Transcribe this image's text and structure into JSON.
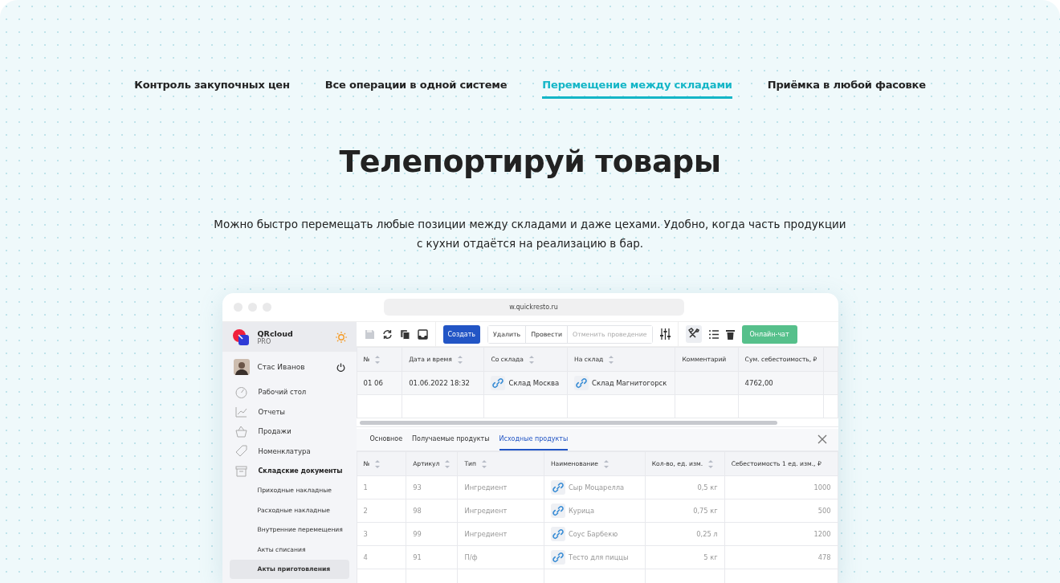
{
  "nav_tabs": [
    {
      "label": "Контроль закупочных цен",
      "selected": false
    },
    {
      "label": "Все операции в одной системе",
      "selected": false
    },
    {
      "label": "Перемещение между складами",
      "selected": true
    },
    {
      "label": "Приёмка в любой фасовке",
      "selected": false
    }
  ],
  "heading": "Телепортируй товары",
  "description": "Можно быстро перемещать любые позиции между складами и даже цехами. Удобно, когда часть продукции с кухни отдаётся на реализацию в бар.",
  "app": {
    "url": "w.quickresto.ru",
    "brand": {
      "name": "QRcloud",
      "plan": "PRO"
    },
    "user": {
      "name": "Стас Иванов"
    },
    "menu": [
      {
        "label": "Рабочий стол",
        "expanded": false
      },
      {
        "label": "Отчеты",
        "expanded": false
      },
      {
        "label": "Продажи",
        "expanded": false
      },
      {
        "label": "Номенклатура",
        "expanded": false
      },
      {
        "label": "Складские документы",
        "expanded": true,
        "children": [
          {
            "label": "Приходные накладные",
            "selected": false
          },
          {
            "label": "Расходные накладные",
            "selected": false
          },
          {
            "label": "Внутренние перемещения",
            "selected": false
          },
          {
            "label": "Акты списания",
            "selected": false
          },
          {
            "label": "Акты приготовления",
            "selected": true
          }
        ]
      }
    ],
    "toolbar": {
      "create": "Создать",
      "actions": [
        {
          "label": "Удалить",
          "disabled": false
        },
        {
          "label": "Провести",
          "disabled": false
        },
        {
          "label": "Отменить проведение",
          "disabled": true
        }
      ],
      "chat": "Онлайн-чат"
    },
    "documents": {
      "columns": [
        {
          "label": "№",
          "sortable": true,
          "kind": "text"
        },
        {
          "label": "Дата и время",
          "sortable": true,
          "kind": "text"
        },
        {
          "label": "Со склада",
          "sortable": true,
          "kind": "link"
        },
        {
          "label": "На склад",
          "sortable": true,
          "kind": "link"
        },
        {
          "label": "Комментарий",
          "sortable": false,
          "kind": "text"
        },
        {
          "label": "Сум. себестоимость, ₽",
          "sortable": false,
          "kind": "text"
        }
      ],
      "rows": [
        [
          "01 06",
          "01.06.2022 18:32",
          "Склад Москва",
          "Склад Магнитогорск",
          "",
          "4762,00"
        ]
      ]
    },
    "detail": {
      "tabs": [
        {
          "label": "Основное",
          "selected": false
        },
        {
          "label": "Получаемые продукты",
          "selected": false
        },
        {
          "label": "Исходные продукты",
          "selected": true
        }
      ],
      "columns": [
        {
          "label": "№",
          "sortable": true,
          "kind": "text"
        },
        {
          "label": "Артикул",
          "sortable": true,
          "kind": "text"
        },
        {
          "label": "Тип",
          "sortable": true,
          "kind": "text"
        },
        {
          "label": "Наименование",
          "sortable": true,
          "kind": "link"
        },
        {
          "label": "Кол-во, ед. изм.",
          "sortable": true,
          "kind": "number"
        },
        {
          "label": "Себестоимость 1 ед. изм., ₽",
          "sortable": false,
          "kind": "number"
        }
      ],
      "rows": [
        [
          "1",
          "93",
          "Ингредиент",
          "Сыр Моцарелла",
          "0,5 кг",
          "1000"
        ],
        [
          "2",
          "98",
          "Ингредиент",
          "Курица",
          "0,75 кг",
          "500"
        ],
        [
          "3",
          "99",
          "Ингредиент",
          "Соус Барбекю",
          "0,25 л",
          "1200"
        ],
        [
          "4",
          "91",
          "П/ф",
          "Тесто для пиццы",
          "5 кг",
          "478"
        ]
      ]
    }
  }
}
